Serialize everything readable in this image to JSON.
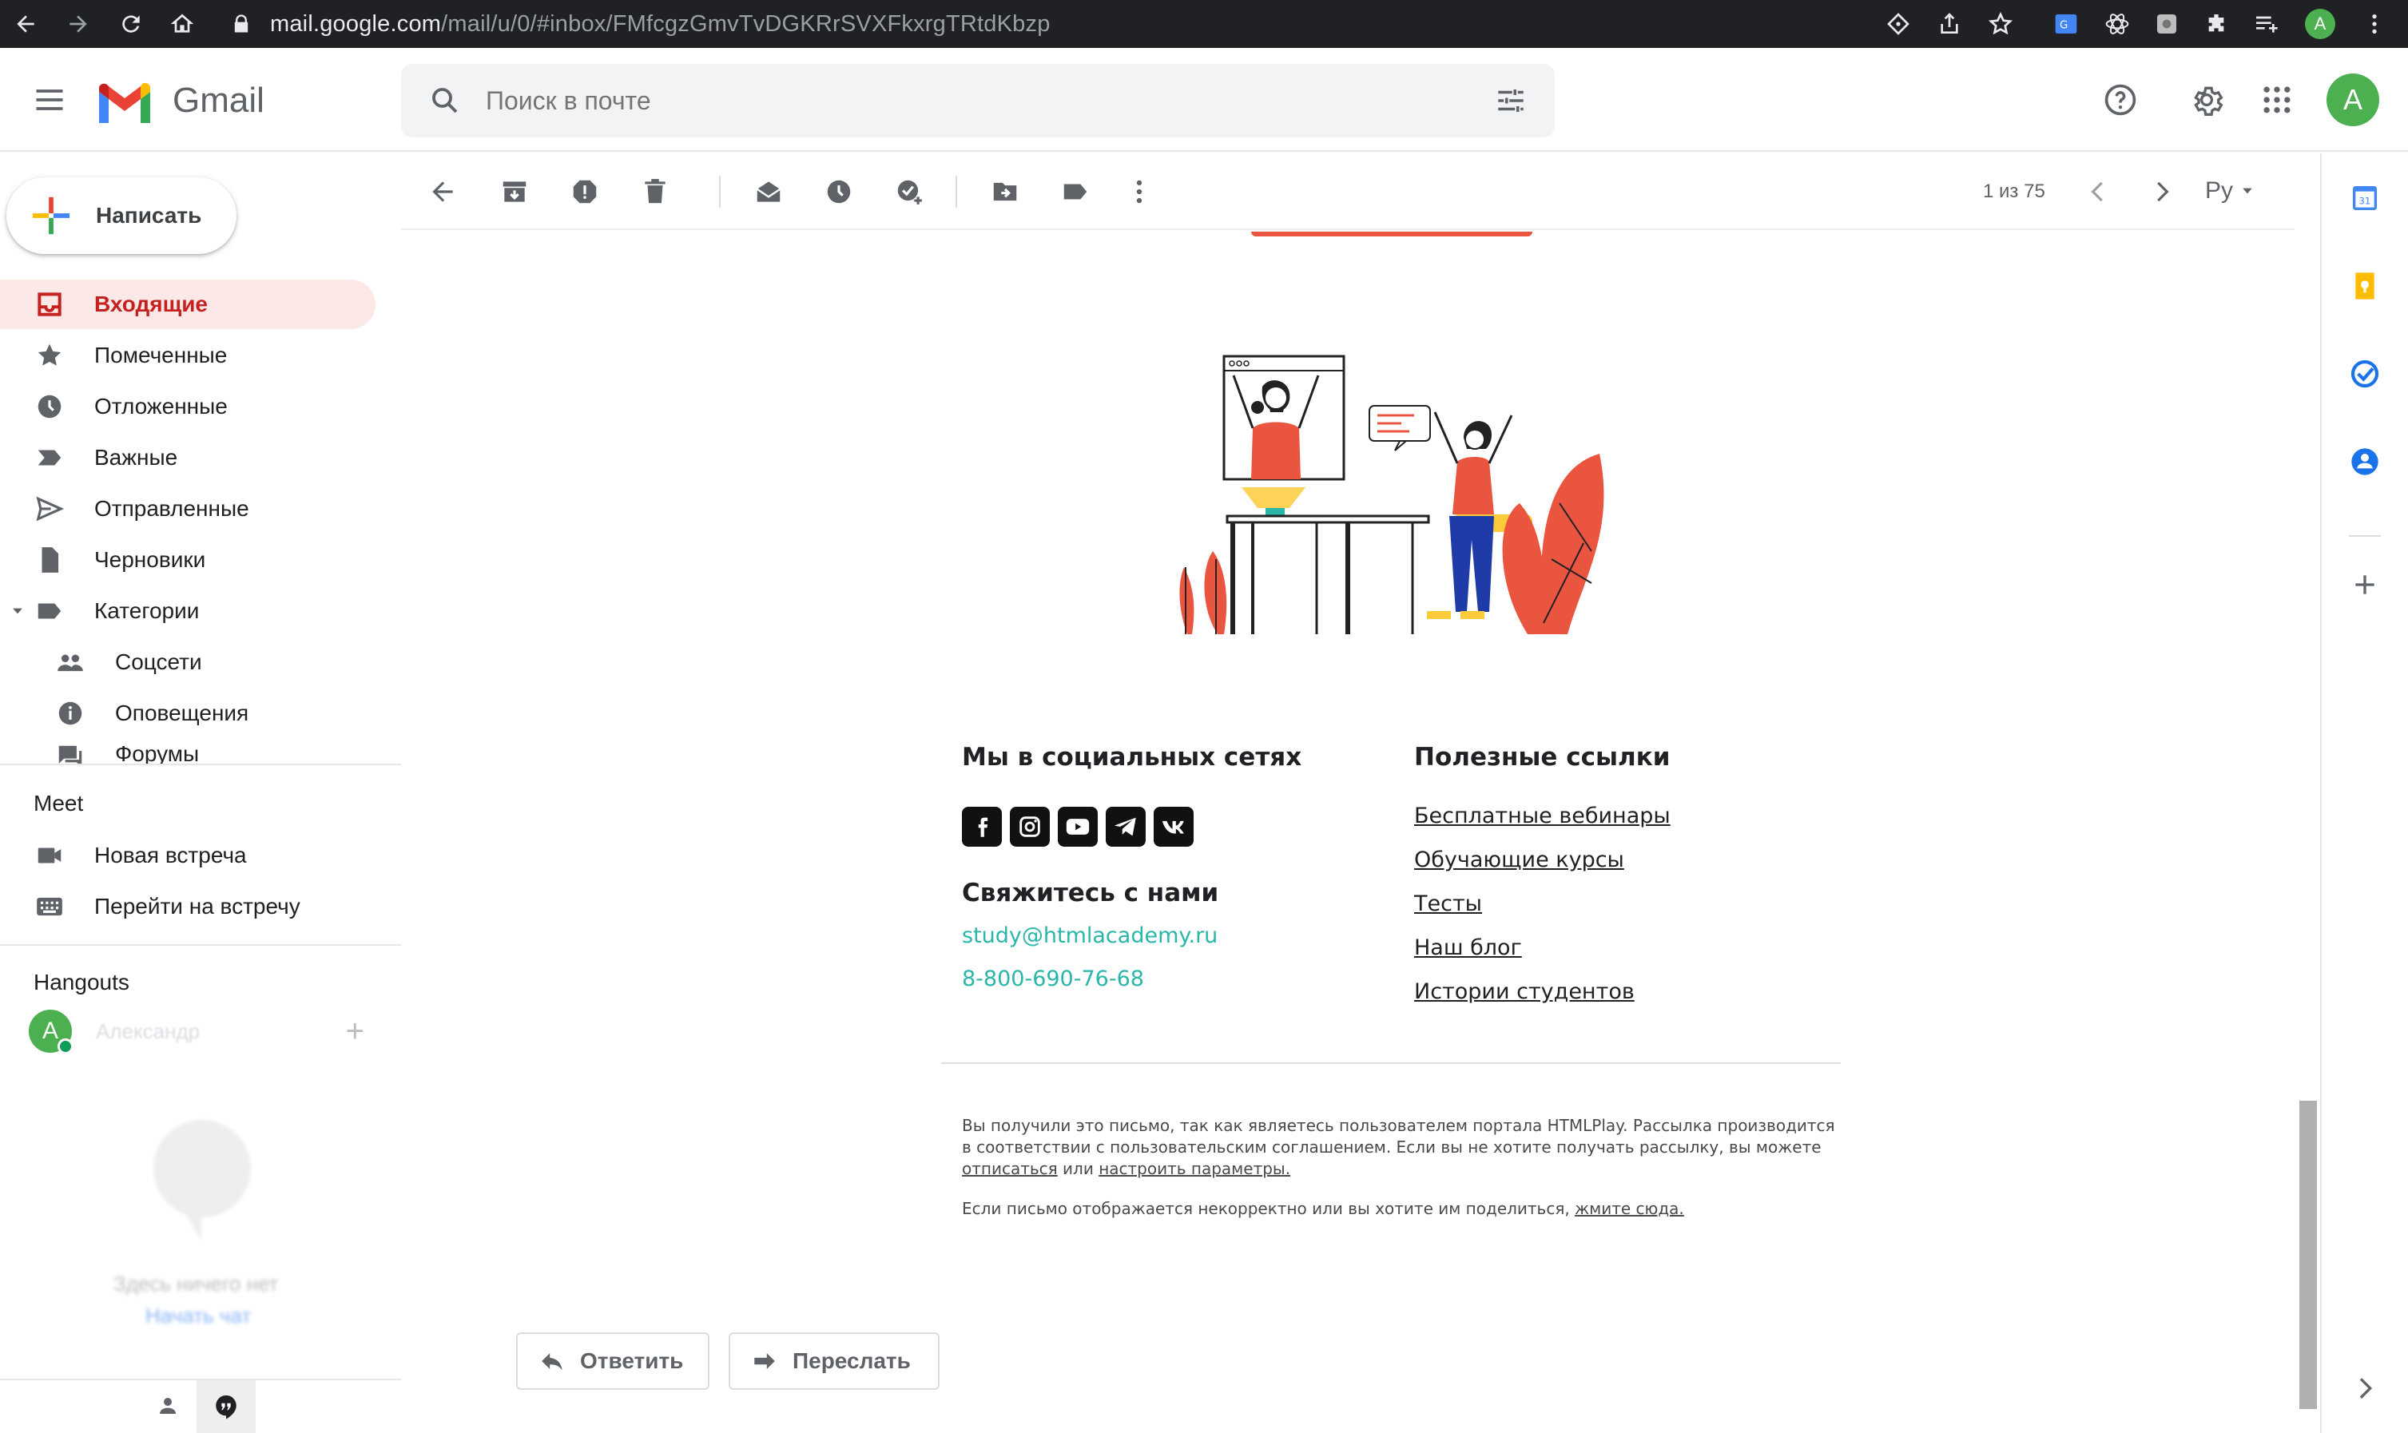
{
  "browser": {
    "url_host": "mail.google.com",
    "url_path": "/mail/u/0/#inbox/FMfcgzGmvTvDGKRrSVXFkxrgTRtdKbzp",
    "profile_initial": "A"
  },
  "header": {
    "app_name": "Gmail",
    "search_placeholder": "Поиск в почте",
    "avatar_initial": "A"
  },
  "sidebar": {
    "compose_label": "Написать",
    "items": [
      {
        "label": "Входящие",
        "icon": "inbox-icon"
      },
      {
        "label": "Помеченные",
        "icon": "star-icon"
      },
      {
        "label": "Отложенные",
        "icon": "clock-icon"
      },
      {
        "label": "Важные",
        "icon": "important-icon"
      },
      {
        "label": "Отправленные",
        "icon": "send-icon"
      },
      {
        "label": "Черновики",
        "icon": "draft-icon"
      },
      {
        "label": "Категории",
        "icon": "label-icon"
      },
      {
        "label": "Соцсети",
        "icon": "people-icon"
      },
      {
        "label": "Оповещения",
        "icon": "info-icon"
      },
      {
        "label": "Форумы",
        "icon": "forum-icon"
      }
    ],
    "meet": {
      "title": "Meet",
      "new_meeting": "Новая встреча",
      "join_meeting": "Перейти на встречу"
    },
    "hangouts": {
      "title": "Hangouts",
      "user_initial": "A",
      "user_name": "Александр",
      "empty_text": "Здесь ничего нет",
      "start_chat": "Начать чат"
    }
  },
  "toolbar": {
    "pagination": "1 из 75",
    "input_tool": "Ру"
  },
  "email": {
    "social_title": "Мы в социальных сетях",
    "contact_title": "Свяжитесь с нами",
    "email": "study@htmlacademy.ru",
    "phone": "8-800-690-76-68",
    "links_title": "Полезные ссылки",
    "links": [
      "Бесплатные вебинары",
      "Обучающие курсы",
      "Тесты",
      "Наш блог",
      "Истории студентов"
    ],
    "footer1_line1": "Вы получили это письмо, так как являетесь пользователем портала HTMLPlay. Рассылка производится",
    "footer1_line2": "в соответствии с пользовательским соглашением. Если вы не хотите получать рассылку, вы можете",
    "unsubscribe": "отписаться",
    "or": " или ",
    "settings_link": "настроить параметры.",
    "footer2": "Если письмо отображается некорректно или вы хотите им поделиться, ",
    "press_here": "жмите сюда."
  },
  "actions": {
    "reply": "Ответить",
    "forward": "Переслать"
  },
  "colors": {
    "accent_red": "#c5221f",
    "active_bg": "#fce8e6",
    "teal": "#2ab7a9",
    "orange_brand": "#ea5540"
  }
}
